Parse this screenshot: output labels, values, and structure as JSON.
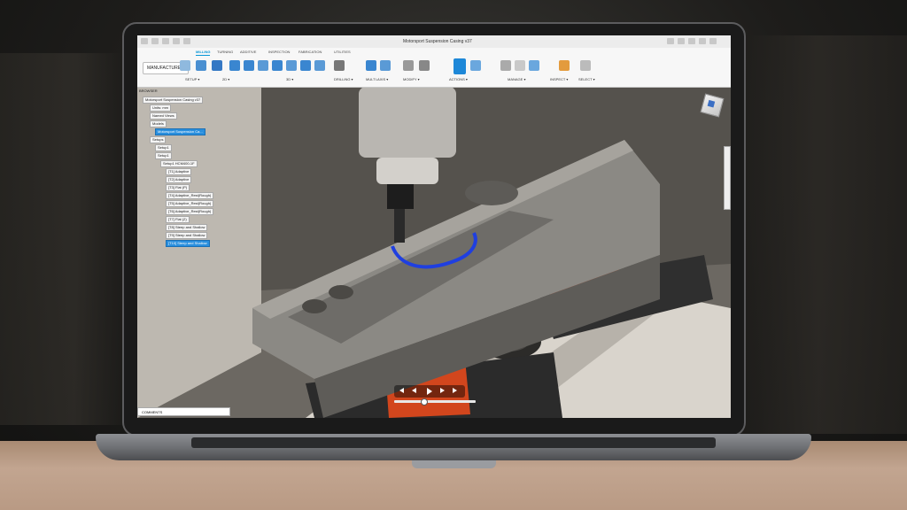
{
  "app": {
    "document_title": "Motorsport Suspension Casing v37",
    "workspace_label": "MANUFACTURE ▾",
    "tabs": [
      "MILLING",
      "TURNING",
      "ADDITIVE",
      "INSPECTION",
      "FABRICATION",
      "UTILITIES"
    ],
    "active_tab": "MILLING",
    "groups": [
      "SETUP ▾",
      "2D ▾",
      "3D ▾",
      "DRILLING ▾",
      "MULTI-AXIS ▾",
      "MODIFY ▾",
      "ACTIONS ▾",
      "MANAGE ▾",
      "INSPECT ▾",
      "SELECT ▾"
    ],
    "accent": "#0696d7"
  },
  "browser": {
    "header": "BROWSER",
    "items": [
      "Motorsport Suspension Casing v37",
      "Units: mm",
      "Named Views",
      "Models",
      "Motorsport Suspension Ca...",
      "Setups",
      "Setup1",
      "Setup1",
      "Setup1 HCM400-1F",
      "[T1] Adaptive",
      "[T2] Adaptive",
      "[T3] Flat (P)",
      "[T4] Adaptive_Rest(Rough)",
      "[T5] Adaptive_Rest(Rough)",
      "[T6] Adaptive_Rest(Rough)",
      "[T7] Flat (2)",
      "[T8] Steep and Shallow",
      "[T9] Steep and Shallow",
      "[T10] Steep and Shallow"
    ],
    "selected_index": 18
  },
  "bottom": {
    "comments_label": "COMMENTS"
  },
  "viewcube": {
    "face_color": "#3b6fc4"
  },
  "toolpath_color": "#1f3fe0",
  "vise_color": "#d2461d"
}
